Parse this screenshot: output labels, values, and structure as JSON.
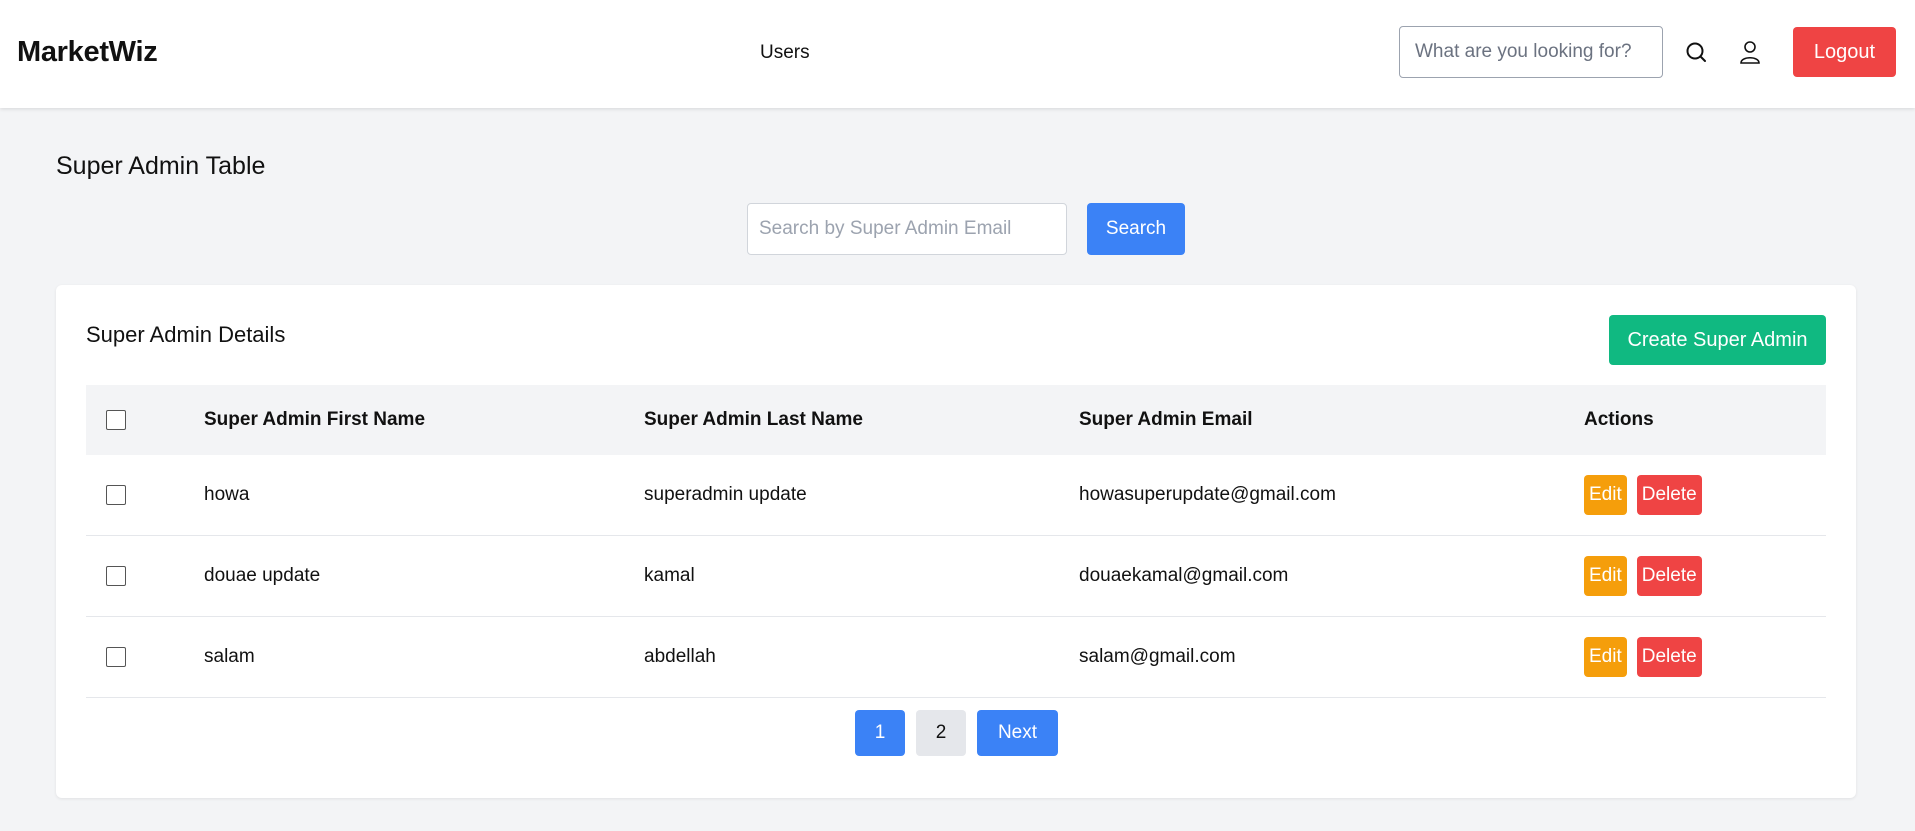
{
  "header": {
    "brand": "MarketWiz",
    "nav_users": "Users",
    "search_placeholder": "What are you looking for?",
    "search_icon": "search-icon",
    "user_icon": "user-icon",
    "logout_label": "Logout"
  },
  "page": {
    "title": "Super Admin Table",
    "search_placeholder": "Search by Super Admin Email",
    "search_label": "Search"
  },
  "card": {
    "title": "Super Admin Details",
    "create_label": "Create Super Admin",
    "columns": [
      "Super Admin First Name",
      "Super Admin Last Name",
      "Super Admin Email",
      "Actions"
    ],
    "rows": [
      {
        "first": "howa",
        "last": "superadmin update",
        "email": "howasuperupdate@gmail.com",
        "edit": "Edit",
        "delete": "Delete"
      },
      {
        "first": "douae update",
        "last": "kamal",
        "email": "douaekamal@gmail.com",
        "edit": "Edit",
        "delete": "Delete"
      },
      {
        "first": "salam",
        "last": "abdellah",
        "email": "salam@gmail.com",
        "edit": "Edit",
        "delete": "Delete"
      }
    ]
  },
  "pagination": {
    "pages": [
      "1",
      "2"
    ],
    "active": "1",
    "next_label": "Next"
  },
  "colors": {
    "primary": "#3b82f6",
    "danger": "#ef4444",
    "success": "#10b981",
    "warning": "#f59e0b"
  }
}
